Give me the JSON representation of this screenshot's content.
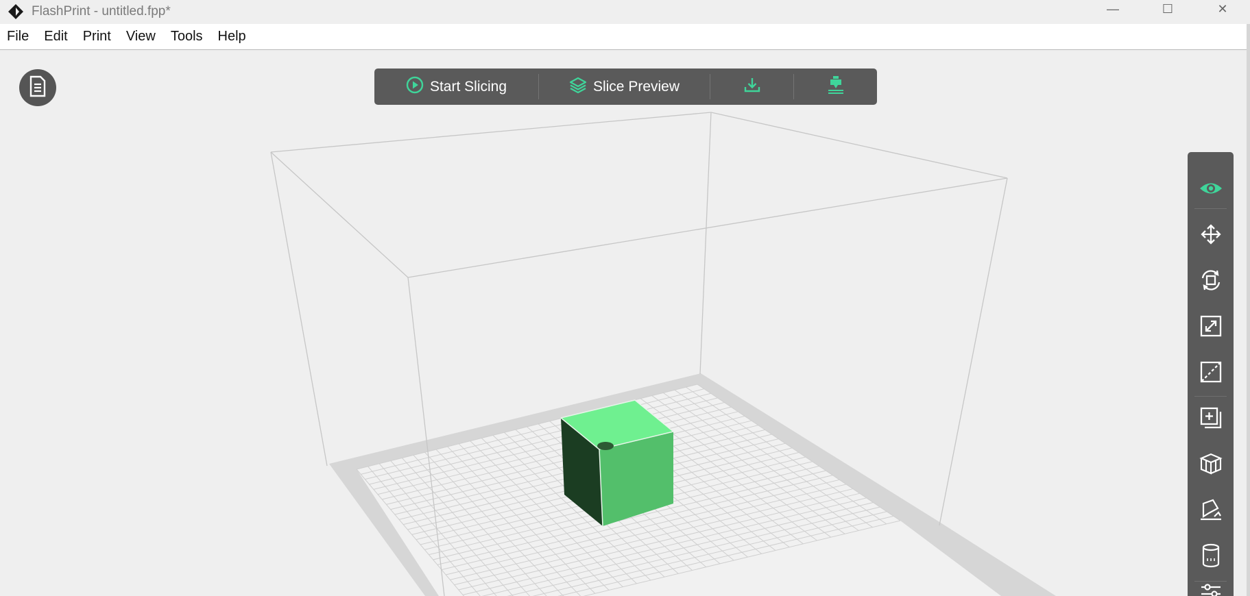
{
  "window": {
    "title": "FlashPrint - untitled.fpp*",
    "controls": {
      "minimize": "—",
      "maximize": "☐",
      "close": "✕"
    }
  },
  "menu": {
    "items": [
      "File",
      "Edit",
      "Print",
      "View",
      "Tools",
      "Help"
    ]
  },
  "toolbar": {
    "start_slicing": "Start Slicing",
    "slice_preview": "Slice Preview",
    "export_icon": "download-icon",
    "print_icon": "printer-nozzle-icon"
  },
  "side_toolbar": {
    "tools": [
      "view-icon",
      "move-icon",
      "rotate-icon",
      "scale-icon",
      "cut-icon",
      "add-model-icon",
      "supports-icon",
      "on-face-icon",
      "hollow-icon",
      "settings-icon"
    ]
  },
  "colors": {
    "accent": "#3fd59a",
    "toolbar_bg": "#5a5a5a",
    "viewport_bg": "#efefef",
    "model_top": "#6ff090",
    "model_front": "#53bf6b",
    "model_side": "#1b3d22"
  }
}
